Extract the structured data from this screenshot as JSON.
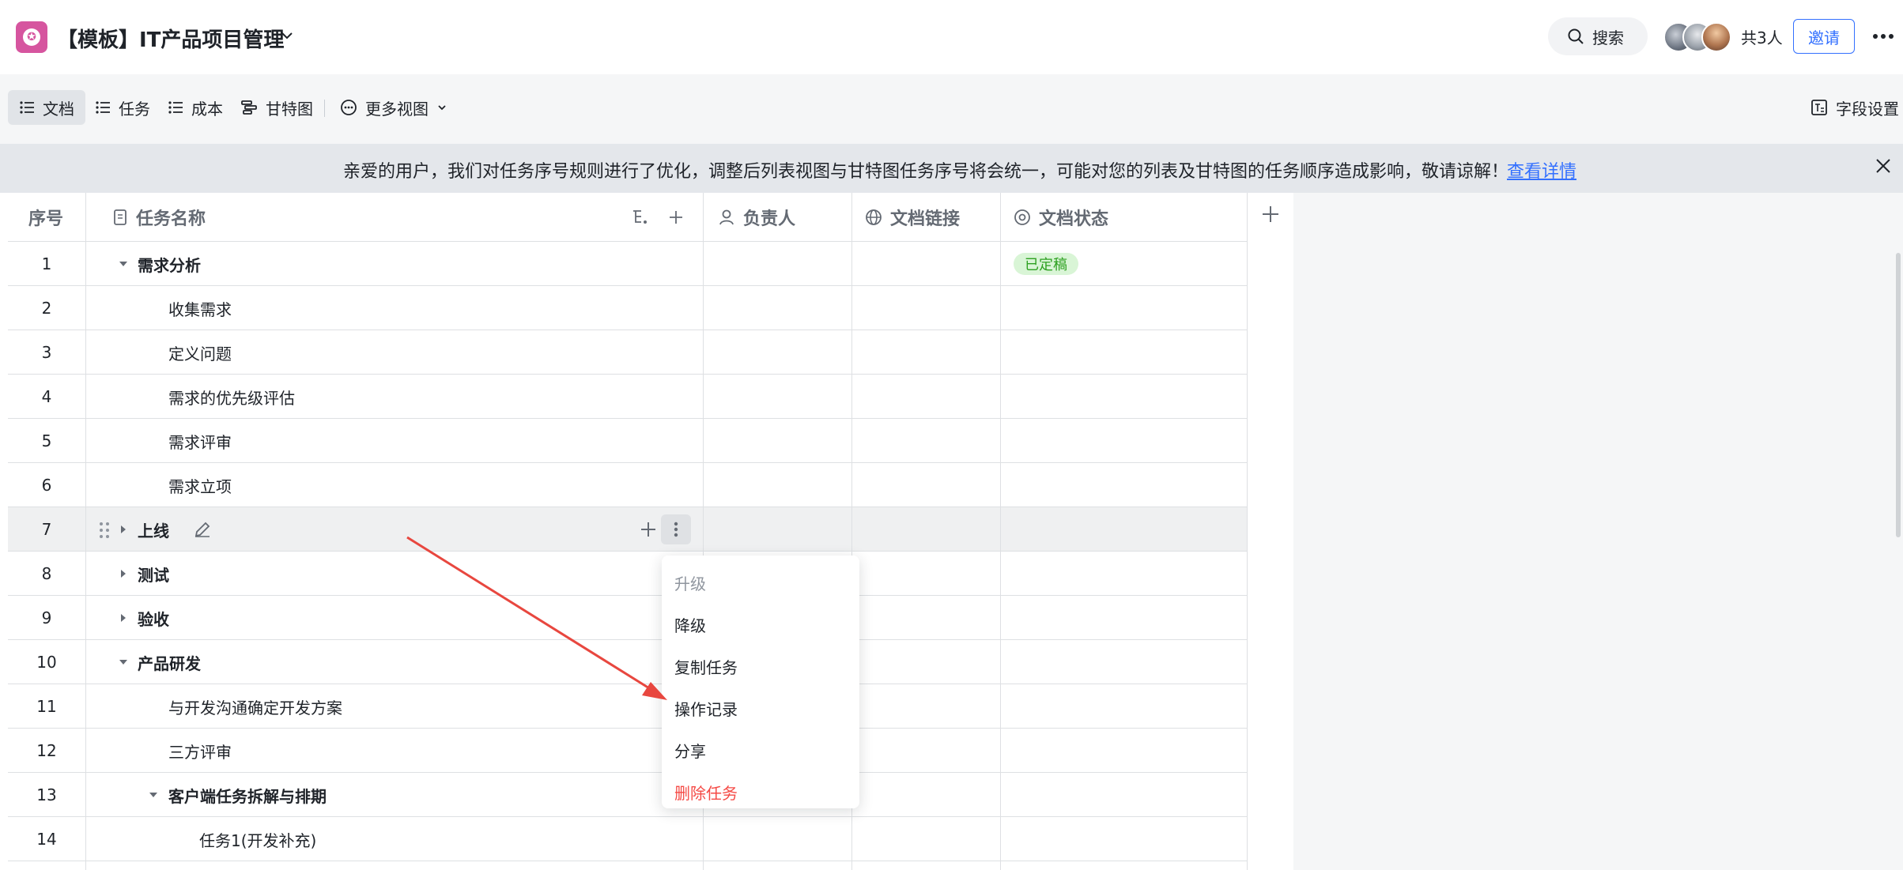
{
  "app": {
    "title": "【模板】IT产品项目管理",
    "brand_color": "#d6559f"
  },
  "header": {
    "search_label": "搜索",
    "member_count": "共3人",
    "invite_label": "邀请"
  },
  "views": {
    "tabs": [
      {
        "label": "文档",
        "icon": "list-icon",
        "active": true
      },
      {
        "label": "任务",
        "icon": "list-icon",
        "active": false
      },
      {
        "label": "成本",
        "icon": "list-icon",
        "active": false
      },
      {
        "label": "甘特图",
        "icon": "gantt-icon",
        "active": false
      }
    ],
    "more_views_label": "更多视图",
    "field_settings_label": "字段设置"
  },
  "notice": {
    "text": "亲爱的用户，我们对任务序号规则进行了优化，调整后列表视图与甘特图任务序号将会统一，可能对您的列表及甘特图的任务顺序造成影响，敬请谅解！",
    "link": "查看详情"
  },
  "table": {
    "columns": [
      "序号",
      "任务名称",
      "负责人",
      "文档链接",
      "文档状态"
    ],
    "rows": [
      {
        "num": "1",
        "name": "需求分析",
        "level": 0,
        "toggle": "expanded",
        "status": "已定稿"
      },
      {
        "num": "2",
        "name": "收集需求",
        "level": 1,
        "toggle": "none",
        "status": ""
      },
      {
        "num": "3",
        "name": "定义问题",
        "level": 1,
        "toggle": "none",
        "status": ""
      },
      {
        "num": "4",
        "name": "需求的优先级评估",
        "level": 1,
        "toggle": "none",
        "status": ""
      },
      {
        "num": "5",
        "name": "需求评审",
        "level": 1,
        "toggle": "none",
        "status": ""
      },
      {
        "num": "6",
        "name": "需求立项",
        "level": 1,
        "toggle": "none",
        "status": ""
      },
      {
        "num": "7",
        "name": "上线",
        "level": 0,
        "toggle": "collapsed",
        "status": "",
        "hover": true
      },
      {
        "num": "8",
        "name": "测试",
        "level": 0,
        "toggle": "collapsed",
        "status": ""
      },
      {
        "num": "9",
        "name": "验收",
        "level": 0,
        "toggle": "collapsed",
        "status": ""
      },
      {
        "num": "10",
        "name": "产品研发",
        "level": 0,
        "toggle": "expanded",
        "status": ""
      },
      {
        "num": "11",
        "name": "与开发沟通确定开发方案",
        "level": 1,
        "toggle": "none",
        "status": ""
      },
      {
        "num": "12",
        "name": "三方评审",
        "level": 1,
        "toggle": "none",
        "status": ""
      },
      {
        "num": "13",
        "name": "客户端任务拆解与排期",
        "level": 1,
        "toggle": "expanded",
        "status": ""
      },
      {
        "num": "14",
        "name": "任务1(开发补充)",
        "level": 2,
        "toggle": "none",
        "status": ""
      }
    ]
  },
  "context_menu": {
    "items": [
      {
        "label": "升级",
        "state": "disabled"
      },
      {
        "label": "降级",
        "state": "normal"
      },
      {
        "label": "复制任务",
        "state": "normal"
      },
      {
        "label": "操作记录",
        "state": "normal"
      },
      {
        "label": "分享",
        "state": "normal"
      },
      {
        "label": "删除任务",
        "state": "danger"
      }
    ]
  },
  "colors": {
    "accent": "#3370ff",
    "danger": "#f54a45",
    "status_done_bg": "#d9f5d6",
    "status_done_text": "#2ea121",
    "annotation_arrow": "#e8473f"
  }
}
